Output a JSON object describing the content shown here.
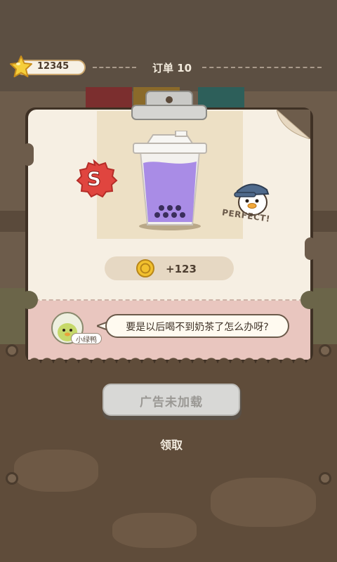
{
  "header": {
    "star_count": "12345",
    "order_title": "订单 10"
  },
  "result": {
    "rank": "S",
    "rating": "PERFECT!",
    "reward": "+123"
  },
  "dialog": {
    "speaker": "小绿鸭",
    "message": "要是以后喝不到奶茶了怎么办呀?"
  },
  "actions": {
    "ad_button_label": "广告未加载",
    "claim_label": "领取"
  },
  "colors": {
    "drink": "#a98ce6",
    "pearls": "#3a2e5c",
    "badge_red": "#e0453f",
    "coin": "#f2c12e"
  }
}
